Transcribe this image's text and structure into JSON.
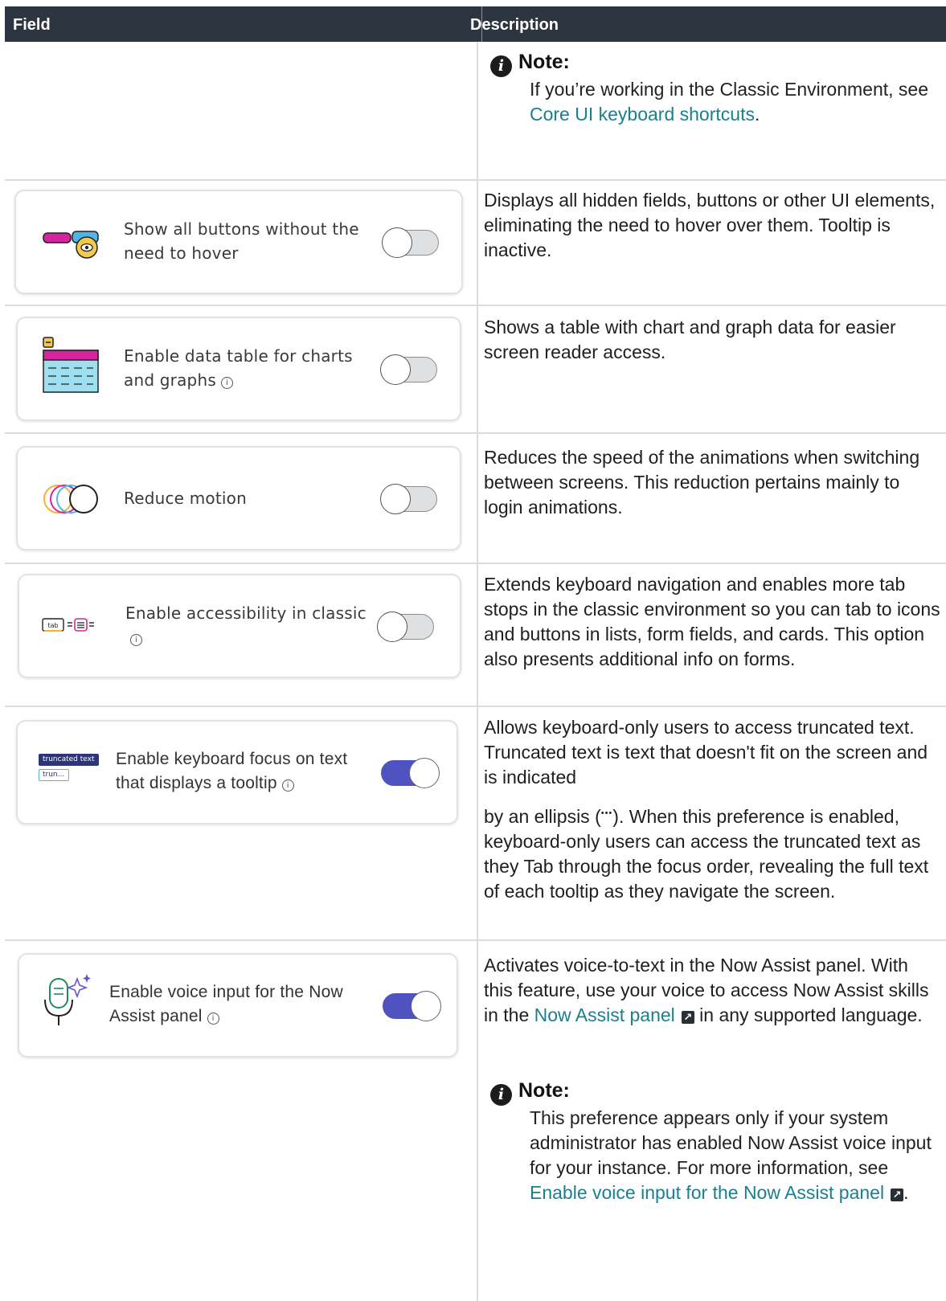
{
  "header": {
    "field": "Field",
    "description": "Description"
  },
  "intro_note": {
    "title": "Note:",
    "text_before": "If you’re working in the Classic Environment, see ",
    "link": "Core UI keyboard shortcuts",
    "text_after": "."
  },
  "rows": [
    {
      "label": "Show all buttons without the need to hover",
      "icon": "hover-buttons-icon",
      "toggle_on": false,
      "info": false,
      "description": "Displays all hidden fields, buttons or other UI elements, eliminating the need to hover over them. Tooltip is inactive."
    },
    {
      "label": "Enable data table for charts and graphs",
      "icon": "data-table-icon",
      "toggle_on": false,
      "info": true,
      "description": "Shows a table with chart and graph data for easier screen reader access."
    },
    {
      "label": "Reduce motion",
      "icon": "overlapping-circles-icon",
      "toggle_on": false,
      "info": false,
      "description": "Reduces the speed of the animations when switching between screens. This reduction pertains mainly to login animations."
    },
    {
      "label": "Enable accessibility in classic",
      "icon": "tab-list-icon",
      "toggle_on": false,
      "info": true,
      "description": "Extends keyboard navigation and enables more tab stops in the classic environment so you can tab to icons and buttons in lists, form fields, and cards. This option also presents additional info on forms."
    },
    {
      "label": "Enable keyboard focus on text that displays a tooltip",
      "icon": "truncated-text-icon",
      "icon_text_1": "truncated text",
      "icon_text_2": "trun...",
      "toggle_on": true,
      "info": true,
      "description_1": "Allows keyboard-only users to access truncated text. Truncated text is text that doesn't fit on the screen and is indicated",
      "description_2_before": "by an ellipsis (",
      "ellipsis": "•••",
      "description_2_after": "). When this preference is enabled, keyboard-only users can access the truncated text as they Tab through the focus order, revealing the full text of each tooltip as they navigate the screen."
    },
    {
      "label": "Enable voice input for the Now Assist panel",
      "icon": "microphone-sparkle-icon",
      "toggle_on": true,
      "info": true,
      "description_before": "Activates voice-to-text in the Now Assist panel. With this feature, use your voice to access Now Assist skills in the ",
      "description_link": "Now Assist panel",
      "description_after": " in any supported language."
    }
  ],
  "voice_note": {
    "title": "Note:",
    "text_before": "This preference appears only if your system administrator has enabled Now Assist voice input for your instance. For more information, see ",
    "link": "Enable voice input for the Now Assist panel",
    "text_after": "."
  },
  "colors": {
    "header_bg": "#2c3540",
    "link": "#1a7f8e",
    "toggle_on": "#4f53c2",
    "toggle_off": "#dfe0e2"
  }
}
